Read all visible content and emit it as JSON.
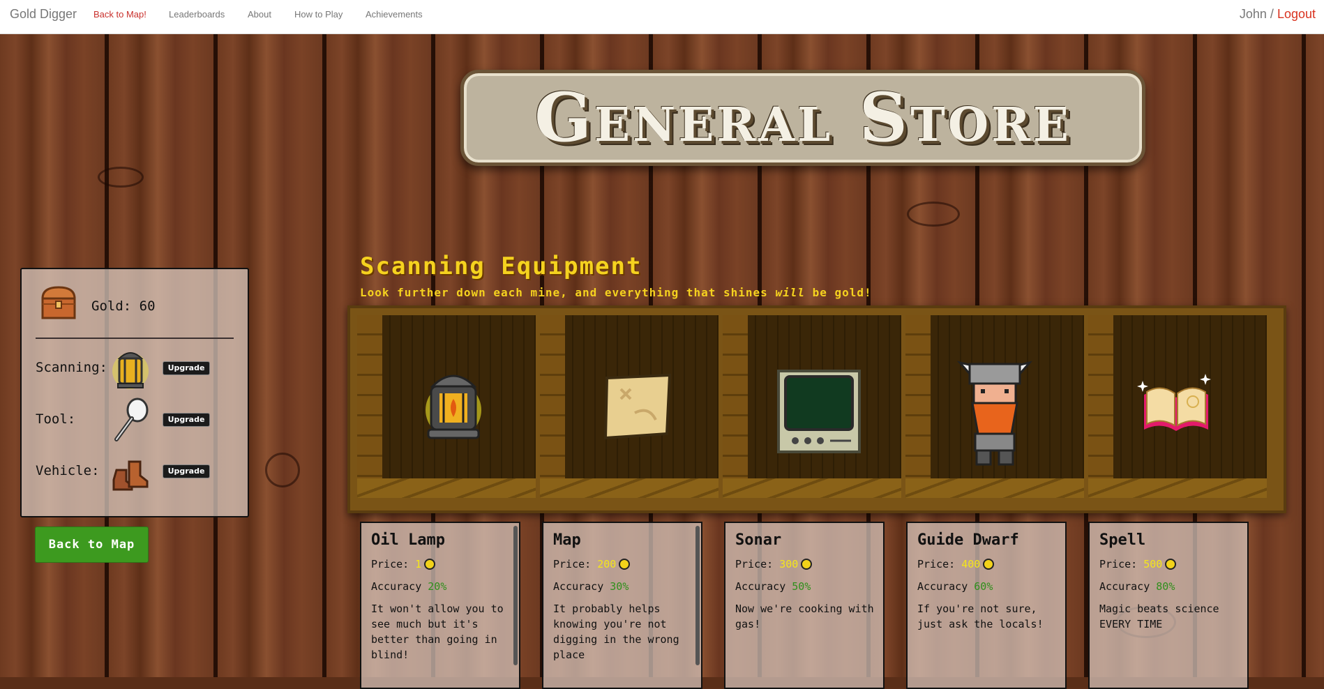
{
  "navbar": {
    "brand": "Gold Digger",
    "links": [
      "Back to Map!",
      "Leaderboards",
      "About",
      "How to Play",
      "Achievements"
    ],
    "user": "John",
    "separator": " / ",
    "logout": "Logout"
  },
  "sign": {
    "title": "General Store"
  },
  "status": {
    "gold_label": "Gold: 60",
    "rows": [
      {
        "label": "Scanning:",
        "icon": "lantern-icon",
        "button": "Upgrade"
      },
      {
        "label": "Tool:",
        "icon": "spoon-icon",
        "button": "Upgrade"
      },
      {
        "label": "Vehicle:",
        "icon": "boots-icon",
        "button": "Upgrade"
      }
    ],
    "back_button": "Back to Map"
  },
  "section": {
    "title": "Scanning Equipment",
    "subtitle_before": "Look further down each mine, and everything that shines ",
    "subtitle_em": "will",
    "subtitle_after": " be gold!"
  },
  "items": [
    {
      "name": "Oil Lamp",
      "price_label": "Price:",
      "price": "1",
      "accuracy_label": "Accuracy",
      "accuracy": "20%",
      "description": "It won't allow you to see much but it's better than going in blind!",
      "icon": "oil-lamp-icon"
    },
    {
      "name": "Map",
      "price_label": "Price:",
      "price": "200",
      "accuracy_label": "Accuracy",
      "accuracy": "30%",
      "description": "It probably helps knowing you're not digging in the wrong place",
      "icon": "treasure-map-icon"
    },
    {
      "name": "Sonar",
      "price_label": "Price:",
      "price": "300",
      "accuracy_label": "Accuracy",
      "accuracy": "50%",
      "description": "Now we're cooking with gas!",
      "icon": "sonar-screen-icon"
    },
    {
      "name": "Guide Dwarf",
      "price_label": "Price:",
      "price": "400",
      "accuracy_label": "Accuracy",
      "accuracy": "60%",
      "description": "If you're not sure, just ask the locals!",
      "icon": "dwarf-icon"
    },
    {
      "name": "Spell",
      "price_label": "Price:",
      "price": "500",
      "accuracy_label": "Accuracy",
      "accuracy": "80%",
      "description": "Magic beats science EVERY TIME",
      "icon": "spellbook-icon"
    }
  ],
  "colors": {
    "accent_gold": "#f5d21f",
    "price_yellow": "#f5e61a",
    "accuracy_green": "#2f8f1c",
    "logout_red": "#d9321f",
    "button_green": "#3d9a1f"
  }
}
